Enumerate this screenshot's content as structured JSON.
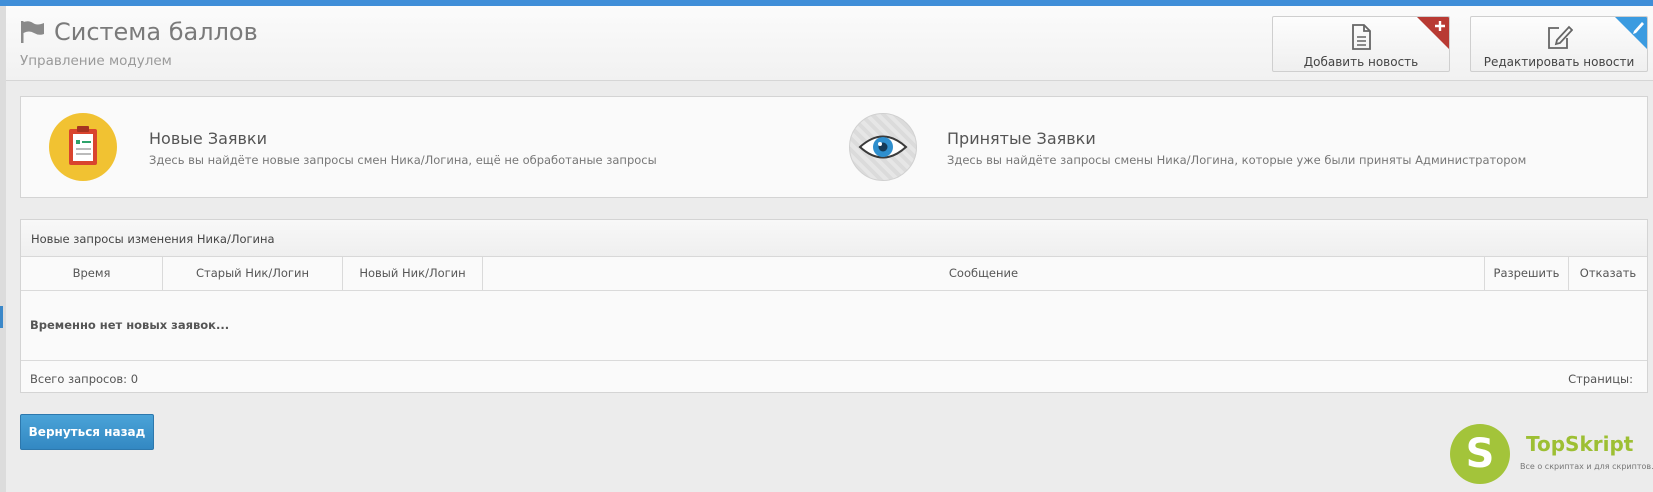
{
  "header": {
    "title": "Система баллов",
    "subtitle": "Управление модулем",
    "buttons": [
      {
        "label": "Добавить новость",
        "icon": "document-icon",
        "corner_icon": "plus-icon",
        "corner_color": "#c0392b"
      },
      {
        "label": "Редактировать новости",
        "icon": "edit-icon",
        "corner_icon": "pencil-icon",
        "corner_color": "#3b9be0"
      }
    ]
  },
  "shortcuts": [
    {
      "title": "Новые Заявки",
      "description": "Здесь вы найдёте новые запросы смен Ника/Логина, ещё не обработаные запросы",
      "icon": "clipboard-icon"
    },
    {
      "title": "Принятые Заявки",
      "description": "Здесь вы найдёте запросы смены Ника/Логина, которые уже были приняты Администратором",
      "icon": "eye-icon"
    }
  ],
  "panel": {
    "heading": "Новые запросы изменения Ника/Логина",
    "columns": [
      "Время",
      "Старый Ник/Логин",
      "Новый Ник/Логин",
      "Сообщение",
      "Разрешить",
      "Отказать"
    ],
    "empty_message": "Временно нет новых заявок...",
    "total_label": "Всего запросов: 0",
    "pages_label": "Страницы:"
  },
  "back_button": "Вернуться назад",
  "logo": {
    "letter": "S",
    "name": "TopSkript",
    "tagline": "Все о скриптах и для скриптов...",
    "color": "#a3c43a"
  },
  "colors": {
    "accent": "#3f8ed8",
    "button_primary": "#3a8fc8"
  }
}
